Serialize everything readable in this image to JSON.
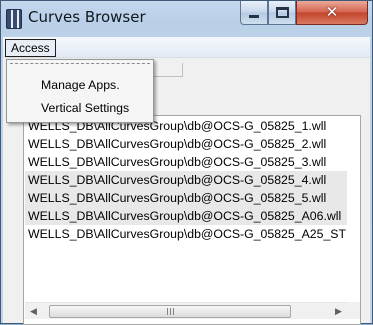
{
  "window": {
    "title": "Curves Browser",
    "controls": {
      "minimize": "minimize",
      "maximize": "maximize",
      "close": "✕"
    }
  },
  "menubar": {
    "access_label": "Access"
  },
  "dropdown": {
    "items": [
      {
        "label": "Manage Apps."
      },
      {
        "label": "Vertical Settings"
      }
    ]
  },
  "list": {
    "items": [
      {
        "label": "WELLS_DB\\AllCurvesGroup\\db@OCS-G_05825_1.wll",
        "selected": false
      },
      {
        "label": "WELLS_DB\\AllCurvesGroup\\db@OCS-G_05825_2.wll",
        "selected": false
      },
      {
        "label": "WELLS_DB\\AllCurvesGroup\\db@OCS-G_05825_3.wll",
        "selected": false
      },
      {
        "label": "WELLS_DB\\AllCurvesGroup\\db@OCS-G_05825_4.wll",
        "selected": true
      },
      {
        "label": "WELLS_DB\\AllCurvesGroup\\db@OCS-G_05825_5.wll",
        "selected": true
      },
      {
        "label": "WELLS_DB\\AllCurvesGroup\\db@OCS-G_05825_A06.wll",
        "selected": true
      },
      {
        "label": "WELLS_DB\\AllCurvesGroup\\db@OCS-G_05825_A25_ST",
        "selected": false
      }
    ]
  },
  "scrollbar": {
    "left_arrow": "◀",
    "right_arrow": "▶"
  },
  "colors": {
    "frame": "#bcd2e9",
    "close_button": "#c2432c",
    "selection_bg": "#e8e8e8"
  }
}
